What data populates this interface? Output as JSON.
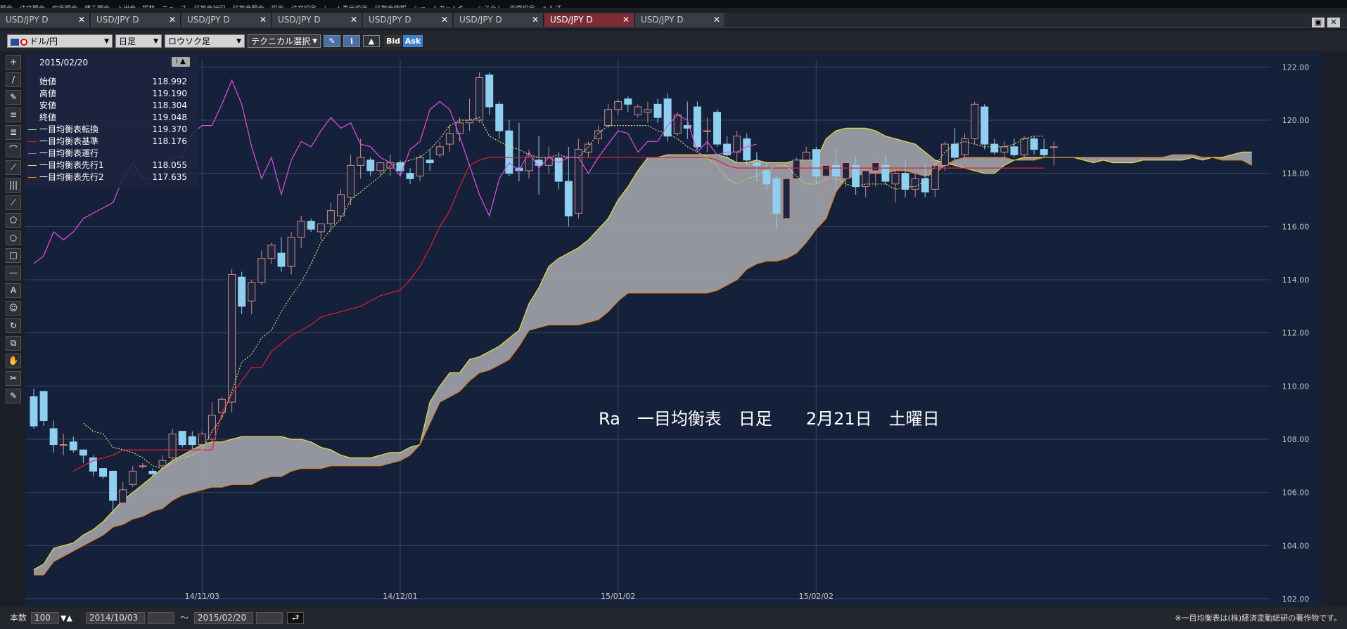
{
  "menubar": {
    "items": [
      "照会",
      "注文照会",
      "約定照会",
      "建玉照会",
      "入出金・振替",
      "ニュース",
      "証拠金状況",
      "証拠金照会",
      "設定",
      "注文設定",
      "レート表示設定",
      "証拠金情報",
      "ショートカットキー",
      "システム",
      "画面設定",
      "ヘルプ"
    ]
  },
  "tabs": [
    {
      "label": "USD/JPY D",
      "active": false
    },
    {
      "label": "USD/JPY D",
      "active": false
    },
    {
      "label": "USD/JPY D",
      "active": false
    },
    {
      "label": "USD/JPY D",
      "active": false
    },
    {
      "label": "USD/JPY D",
      "active": false
    },
    {
      "label": "USD/JPY D",
      "active": false
    },
    {
      "label": "USD/JPY D",
      "active": true
    },
    {
      "label": "USD/JPY D",
      "active": false
    }
  ],
  "tab_close": "✕",
  "window": {
    "restore": "▣",
    "close": "✕"
  },
  "toolbar": {
    "pair": "ドル/円",
    "period": "日足",
    "chart_type": "ロウソク足",
    "technical": "テクニカル選択",
    "bid": "Bid",
    "ask": "Ask",
    "arrow": "▼"
  },
  "left_tools": [
    "+",
    "/",
    "✎",
    "≡",
    "≣",
    "⌒",
    "⟋",
    "|||",
    "⟋",
    "⬠",
    "○",
    "□",
    "—",
    "A",
    "☺",
    "↻",
    "⧉",
    "✋",
    "✂",
    "✎"
  ],
  "info_panel": {
    "date": "2015/02/20",
    "btn": "i ▲",
    "rows": [
      {
        "label": "始値",
        "value": "118.992",
        "color": ""
      },
      {
        "label": "高値",
        "value": "119.190",
        "color": ""
      },
      {
        "label": "安値",
        "value": "118.304",
        "color": ""
      },
      {
        "label": "終値",
        "value": "119.048",
        "color": ""
      },
      {
        "label": "一目均衡表転換",
        "value": "119.370",
        "color": "#c8e070"
      },
      {
        "label": "一目均衡表基準",
        "value": "118.176",
        "color": "#e02030"
      },
      {
        "label": "一目均衡表運行",
        "value": "",
        "color": "#e050e0"
      },
      {
        "label": "一目均衡表先行1",
        "value": "118.055",
        "color": "#e8e040"
      },
      {
        "label": "一目均衡表先行2",
        "value": "117.635",
        "color": "#e08020"
      }
    ]
  },
  "chart_data": {
    "type": "candlestick",
    "y_ticks": [
      "102.00",
      "104.00",
      "106.00",
      "108.00",
      "110.00",
      "112.00",
      "114.00",
      "116.00",
      "118.00",
      "120.00",
      "122.00"
    ],
    "ylim": [
      102,
      122.3
    ],
    "x_ticks": [
      {
        "label": "14/11/03",
        "index": 17
      },
      {
        "label": "14/12/01",
        "index": 37
      },
      {
        "label": "15/01/02",
        "index": 59
      },
      {
        "label": "15/02/02",
        "index": 79
      }
    ],
    "x_slots": 125,
    "annotation": "Ra　一目均衡表　日足　　2月21日　土曜日",
    "footer_note": "※一目均衡表は(株)経済変動総研の著作物です。",
    "colors": {
      "up": "#1c2640",
      "up_border": "#d08888",
      "down": "#8fd0f0",
      "tenkan": "#c8e070",
      "kijun": "#e02030",
      "chikou": "#e050e0",
      "span1": "#e8e040",
      "span2": "#e08020",
      "cloud": "#9a9ca4"
    },
    "candles": [
      [
        109.6,
        109.9,
        108.4,
        108.5
      ],
      [
        109.8,
        109.8,
        108.5,
        108.7
      ],
      [
        108.4,
        108.7,
        107.5,
        107.8
      ],
      [
        107.8,
        108.2,
        107.4,
        107.8
      ],
      [
        107.9,
        108.1,
        107.5,
        107.6
      ],
      [
        107.6,
        107.6,
        107.1,
        107.4
      ],
      [
        107.3,
        107.4,
        106.6,
        106.8
      ],
      [
        106.9,
        106.9,
        106.5,
        106.6
      ],
      [
        106.8,
        106.8,
        105.2,
        105.7
      ],
      [
        105.6,
        106.4,
        105.4,
        106.1
      ],
      [
        106.3,
        107.0,
        106.2,
        106.8
      ],
      [
        107.0,
        107.1,
        106.9,
        107.0
      ],
      [
        106.8,
        106.9,
        106.6,
        106.7
      ],
      [
        107.0,
        107.4,
        106.9,
        107.2
      ],
      [
        107.3,
        108.4,
        107.2,
        108.2
      ],
      [
        108.3,
        108.3,
        107.7,
        107.8
      ],
      [
        108.1,
        108.3,
        107.6,
        107.8
      ],
      [
        107.8,
        108.3,
        107.6,
        108.2
      ],
      [
        108.0,
        109.4,
        107.8,
        108.9
      ],
      [
        109.0,
        109.6,
        108.8,
        109.5
      ],
      [
        109.4,
        114.4,
        109.0,
        114.2
      ],
      [
        114.1,
        114.3,
        112.7,
        113.0
      ],
      [
        113.2,
        114.0,
        112.7,
        113.9
      ],
      [
        113.9,
        115.1,
        113.8,
        114.8
      ],
      [
        114.8,
        115.4,
        114.6,
        115.3
      ],
      [
        115.0,
        115.6,
        114.3,
        114.5
      ],
      [
        114.5,
        115.8,
        114.2,
        115.6
      ],
      [
        115.6,
        116.4,
        115.2,
        116.2
      ],
      [
        116.2,
        116.3,
        115.8,
        115.9
      ],
      [
        115.8,
        116.1,
        115.5,
        116.1
      ],
      [
        116.1,
        116.9,
        115.8,
        116.6
      ],
      [
        116.4,
        117.4,
        116.2,
        117.2
      ],
      [
        117.1,
        118.7,
        116.8,
        118.3
      ],
      [
        118.3,
        119.3,
        117.8,
        118.6
      ],
      [
        118.5,
        118.6,
        117.9,
        118.1
      ],
      [
        118.1,
        118.4,
        117.9,
        118.4
      ],
      [
        118.2,
        118.7,
        117.9,
        118.4
      ],
      [
        118.4,
        118.5,
        117.9,
        118.1
      ],
      [
        118.0,
        118.2,
        117.6,
        117.8
      ],
      [
        117.9,
        118.7,
        117.7,
        118.6
      ],
      [
        118.5,
        118.9,
        118.1,
        118.4
      ],
      [
        118.7,
        119.2,
        118.6,
        119.0
      ],
      [
        119.1,
        119.8,
        118.8,
        119.5
      ],
      [
        119.5,
        120.1,
        119.2,
        119.9
      ],
      [
        119.9,
        120.8,
        119.6,
        120.0
      ],
      [
        120.0,
        121.8,
        119.9,
        121.6
      ],
      [
        121.7,
        121.8,
        120.2,
        120.5
      ],
      [
        120.6,
        120.7,
        119.3,
        119.6
      ],
      [
        119.6,
        120.0,
        117.9,
        118.0
      ],
      [
        118.2,
        119.9,
        117.7,
        118.1
      ],
      [
        118.1,
        118.9,
        117.8,
        118.6
      ],
      [
        118.5,
        119.4,
        117.2,
        118.3
      ],
      [
        118.3,
        119.0,
        118.0,
        118.6
      ],
      [
        118.6,
        118.8,
        117.4,
        117.7
      ],
      [
        117.7,
        119.0,
        116.0,
        116.4
      ],
      [
        116.5,
        119.3,
        116.3,
        118.9
      ],
      [
        118.8,
        119.2,
        118.6,
        119.1
      ],
      [
        119.3,
        119.8,
        119.1,
        119.6
      ],
      [
        119.8,
        120.6,
        119.7,
        120.4
      ],
      [
        120.4,
        120.8,
        120.2,
        120.7
      ],
      [
        120.8,
        120.9,
        120.3,
        120.6
      ],
      [
        120.2,
        120.6,
        120.1,
        120.5
      ],
      [
        120.3,
        120.7,
        119.9,
        120.4
      ],
      [
        120.6,
        120.8,
        119.9,
        120.1
      ],
      [
        120.8,
        121.0,
        119.2,
        119.4
      ],
      [
        119.5,
        120.3,
        119.4,
        120.2
      ],
      [
        119.8,
        120.7,
        119.3,
        119.7
      ],
      [
        120.5,
        120.7,
        118.9,
        119.0
      ],
      [
        119.6,
        120.1,
        118.8,
        119.6
      ],
      [
        120.3,
        120.4,
        119.0,
        119.1
      ],
      [
        119.1,
        119.4,
        118.6,
        118.7
      ],
      [
        118.8,
        119.6,
        118.1,
        119.4
      ],
      [
        119.3,
        119.5,
        118.3,
        118.5
      ],
      [
        118.4,
        118.8,
        117.7,
        118.3
      ],
      [
        118.1,
        118.4,
        117.4,
        117.6
      ],
      [
        117.8,
        117.9,
        115.9,
        116.5
      ],
      [
        116.3,
        117.9,
        116.2,
        117.8
      ],
      [
        117.8,
        118.6,
        117.6,
        118.5
      ],
      [
        118.5,
        119.0,
        117.9,
        118.8
      ],
      [
        118.9,
        119.0,
        117.6,
        117.9
      ],
      [
        117.9,
        118.4,
        117.5,
        118.3
      ],
      [
        118.3,
        118.9,
        117.4,
        117.9
      ],
      [
        117.8,
        118.5,
        117.5,
        118.4
      ],
      [
        118.3,
        118.6,
        117.2,
        117.5
      ],
      [
        117.5,
        118.3,
        117.1,
        118.1
      ],
      [
        118.1,
        118.6,
        117.5,
        118.4
      ],
      [
        118.3,
        118.7,
        117.6,
        117.7
      ],
      [
        117.6,
        118.2,
        116.9,
        118.0
      ],
      [
        118.0,
        118.5,
        117.1,
        117.4
      ],
      [
        117.4,
        118.0,
        117.1,
        117.8
      ],
      [
        117.8,
        118.4,
        117.1,
        117.3
      ],
      [
        117.4,
        118.4,
        117.1,
        118.3
      ],
      [
        118.3,
        119.2,
        118.1,
        119.1
      ],
      [
        119.1,
        119.7,
        118.5,
        118.6
      ],
      [
        118.7,
        119.5,
        118.5,
        119.3
      ],
      [
        119.3,
        120.7,
        119.1,
        120.6
      ],
      [
        120.5,
        120.6,
        118.9,
        119.1
      ],
      [
        119.1,
        119.3,
        118.7,
        118.8
      ],
      [
        118.8,
        119.2,
        118.5,
        119.0
      ],
      [
        119.0,
        119.3,
        118.6,
        118.7
      ],
      [
        118.7,
        119.4,
        118.5,
        119.3
      ],
      [
        119.3,
        119.4,
        118.7,
        118.9
      ],
      [
        118.9,
        119.3,
        118.6,
        118.7
      ],
      [
        119.0,
        119.2,
        118.3,
        119.0
      ]
    ],
    "tenkan": [
      null,
      null,
      null,
      null,
      null,
      108.6,
      108.3,
      108.2,
      107.7,
      107.6,
      107.5,
      107.3,
      107.0,
      106.9,
      107.1,
      107.3,
      107.4,
      107.6,
      108.3,
      108.8,
      109.8,
      110.9,
      111.2,
      111.8,
      112.1,
      112.8,
      113.4,
      113.9,
      114.6,
      115.4,
      115.9,
      116.3,
      117.0,
      117.3,
      117.6,
      117.9,
      118.3,
      118.4,
      118.5,
      118.6,
      118.9,
      119.3,
      119.8,
      120.0,
      120.0,
      120.1,
      119.4,
      119.2,
      119.0,
      118.9,
      118.7,
      118.6,
      118.6,
      118.7,
      118.6,
      118.6,
      119.0,
      119.5,
      119.8,
      119.8,
      119.8,
      119.8,
      119.8,
      119.6,
      119.5,
      119.3,
      119.0,
      118.8,
      118.6,
      118.3,
      117.8,
      117.6,
      117.8,
      117.9,
      118.1,
      118.3,
      118.3,
      117.9,
      117.6,
      117.6,
      117.8,
      117.8,
      117.6,
      117.5,
      117.6,
      117.6,
      117.6,
      117.4,
      117.5,
      117.5,
      117.7,
      118.3,
      118.8,
      119.1,
      119.2,
      119.1,
      119.0,
      119.0,
      119.0,
      119.1,
      119.3,
      119.4,
      119.4
    ],
    "kijun": [
      null,
      null,
      null,
      null,
      106.8,
      107.0,
      107.2,
      107.3,
      107.4,
      107.6,
      107.6,
      107.6,
      107.6,
      107.6,
      107.6,
      107.6,
      107.6,
      107.6,
      107.6,
      109.0,
      109.7,
      110.2,
      110.7,
      110.7,
      111.3,
      111.6,
      111.9,
      112.1,
      112.3,
      112.6,
      112.7,
      112.8,
      112.9,
      113.0,
      113.2,
      113.4,
      113.5,
      113.6,
      114.0,
      114.5,
      115.2,
      116.0,
      116.6,
      117.5,
      118.3,
      118.5,
      118.6,
      118.6,
      118.6,
      118.6,
      118.6,
      118.6,
      118.6,
      118.6,
      118.6,
      118.6,
      118.6,
      118.6,
      118.6,
      118.6,
      118.6,
      118.6,
      118.6,
      118.6,
      118.6,
      118.6,
      118.6,
      118.6,
      118.6,
      118.5,
      118.3,
      118.2,
      118.2,
      118.2,
      118.2,
      118.2,
      118.2,
      118.2,
      118.2,
      118.2,
      118.2,
      118.2,
      118.2,
      118.2,
      118.2,
      118.2,
      118.2,
      118.2,
      118.2,
      118.2,
      118.2,
      118.2,
      118.2,
      118.2,
      118.2,
      118.2,
      118.2,
      118.2,
      118.2,
      118.2,
      118.2,
      118.2,
      118.2
    ],
    "chikou": [
      114.6,
      114.9,
      115.8,
      115.5,
      115.8,
      116.3,
      116.5,
      116.7,
      116.9,
      117.8,
      118.4,
      117.8,
      117.8,
      117.8,
      118.6,
      118.6,
      119.5,
      119.8,
      119.8,
      120.6,
      121.5,
      120.6,
      119.0,
      117.8,
      118.6,
      117.2,
      118.5,
      119.2,
      119.0,
      119.6,
      120.1,
      119.7,
      119.9,
      119.1,
      119.0,
      118.6,
      118.4,
      117.9,
      118.9,
      119.2,
      120.4,
      120.7,
      120.4,
      119.4,
      118.3,
      117.2,
      116.4,
      117.8,
      118.4,
      118.1,
      118.8,
      118.2,
      118.6,
      118.4,
      118.6,
      118.6,
      118.0,
      118.6,
      119.1,
      119.6,
      119.5,
      118.8,
      119.2,
      119.2,
      119.8,
      120.2,
      120.0,
      118.8,
      119.2,
      118.7,
      118.8,
      118.8,
      119.0,
      119.1
    ],
    "cloud_offset": 0,
    "span1": [
      103.1,
      103.3,
      103.9,
      104.0,
      104.1,
      104.4,
      104.6,
      104.9,
      105.3,
      105.7,
      106.0,
      106.3,
      106.6,
      106.9,
      107.2,
      107.4,
      107.6,
      107.8,
      107.9,
      107.9,
      108.0,
      108.1,
      108.1,
      108.1,
      108.1,
      108.1,
      108.0,
      108.0,
      107.9,
      107.7,
      107.6,
      107.4,
      107.3,
      107.3,
      107.3,
      107.4,
      107.5,
      107.5,
      107.7,
      107.8,
      109.4,
      110.0,
      110.5,
      110.5,
      111.0,
      111.1,
      111.3,
      111.5,
      111.8,
      112.1,
      113.1,
      113.7,
      114.5,
      114.8,
      115.0,
      115.2,
      115.5,
      115.9,
      116.3,
      117.0,
      117.5,
      118.1,
      118.6,
      118.6,
      118.7,
      118.7,
      118.7,
      118.7,
      118.7,
      118.7,
      118.6,
      118.4,
      118.4,
      118.5,
      118.4,
      118.4,
      118.4,
      118.5,
      118.5,
      118.5,
      119.3,
      119.6,
      119.7,
      119.7,
      119.7,
      119.6,
      119.4,
      119.3,
      119.2,
      119.1,
      118.8,
      118.5,
      118.4,
      118.3,
      118.2,
      118.1,
      118.0,
      118.0,
      118.3,
      118.5,
      118.6,
      118.6,
      118.6,
      118.6,
      118.6,
      118.6,
      118.5,
      118.4,
      118.5,
      118.4,
      118.4,
      118.4,
      118.5,
      118.5,
      118.5,
      118.5,
      118.5,
      118.6,
      118.5,
      118.6,
      118.6,
      118.7,
      118.8,
      118.8
    ],
    "span2": [
      102.9,
      102.9,
      103.4,
      103.6,
      103.8,
      104.0,
      104.2,
      104.4,
      104.7,
      104.8,
      105.0,
      105.1,
      105.3,
      105.4,
      105.7,
      105.9,
      106.0,
      106.1,
      106.2,
      106.2,
      106.3,
      106.3,
      106.3,
      106.5,
      106.6,
      106.6,
      106.8,
      106.9,
      106.9,
      106.9,
      107.0,
      107.0,
      107.0,
      107.0,
      107.0,
      107.0,
      107.1,
      107.2,
      107.4,
      107.8,
      108.6,
      109.4,
      109.6,
      109.8,
      110.2,
      110.5,
      110.6,
      110.8,
      111.0,
      111.5,
      112.1,
      112.2,
      112.3,
      112.3,
      112.3,
      112.3,
      112.4,
      112.5,
      112.8,
      113.2,
      113.5,
      113.5,
      113.5,
      113.5,
      113.5,
      113.5,
      113.5,
      113.5,
      113.5,
      113.6,
      113.8,
      114.0,
      114.4,
      114.6,
      114.7,
      114.7,
      114.8,
      115.0,
      115.4,
      115.9,
      116.3,
      117.3,
      117.8,
      117.9,
      118.0,
      118.0,
      118.0,
      118.1,
      118.1,
      118.0,
      117.9,
      118.0,
      118.3,
      118.5,
      118.6,
      118.6,
      118.6,
      118.6,
      118.6,
      118.5,
      118.5,
      118.5,
      118.6,
      118.6,
      118.6,
      118.6,
      118.6,
      118.6,
      118.6,
      118.6,
      118.6,
      118.6,
      118.6,
      118.6,
      118.6,
      118.7,
      118.7,
      118.7,
      118.6,
      118.6,
      118.5,
      118.5,
      118.5,
      118.3
    ]
  },
  "bottom": {
    "bars_label": "本数",
    "bars_value": "100",
    "arrows": "▼▲",
    "start_date": "2014/10/03",
    "tilde": "～",
    "end_date": "2015/02/20",
    "return_icon": "⮐",
    "note": "※一目均衡表は(株)経済変動総研の著作物です。"
  }
}
